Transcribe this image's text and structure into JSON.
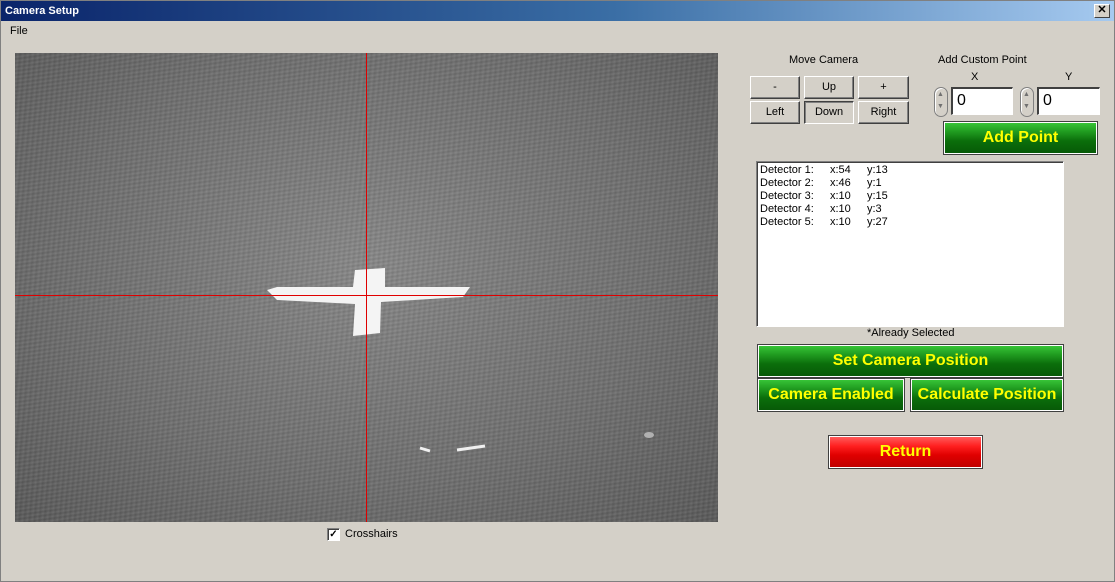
{
  "window": {
    "title": "Camera Setup",
    "close_glyph": "✕"
  },
  "menu": {
    "file": "File"
  },
  "camera": {
    "crosshairs_label": "Crosshairs",
    "crosshairs_checked": true,
    "check_glyph": "✓"
  },
  "move_camera": {
    "title": "Move Camera",
    "minus": "-",
    "up": "Up",
    "plus": "+",
    "left": "Left",
    "down": "Down",
    "right": "Right"
  },
  "custom_point": {
    "title": "Add Custom Point",
    "x_label": "X",
    "y_label": "Y",
    "x_value": "0",
    "y_value": "0",
    "add_button": "Add Point"
  },
  "detectors": [
    {
      "name": "Detector 1:",
      "x": "x:54",
      "y": "y:13"
    },
    {
      "name": "Detector 2:",
      "x": "x:46",
      "y": "y:1"
    },
    {
      "name": "Detector 3:",
      "x": "x:10",
      "y": "y:15"
    },
    {
      "name": "Detector 4:",
      "x": "x:10",
      "y": "y:3"
    },
    {
      "name": "Detector 5:",
      "x": "x:10",
      "y": "y:27"
    }
  ],
  "already_selected_note": "*Already Selected",
  "actions": {
    "set_camera_position": "Set Camera Position",
    "camera_enabled": "Camera Enabled",
    "calculate_position": "Calculate Position",
    "return": "Return"
  },
  "colors": {
    "green_button": "#0b6e0b",
    "red_button": "#e00000",
    "button_text": "#ffff00",
    "crosshair": "#e00000"
  }
}
